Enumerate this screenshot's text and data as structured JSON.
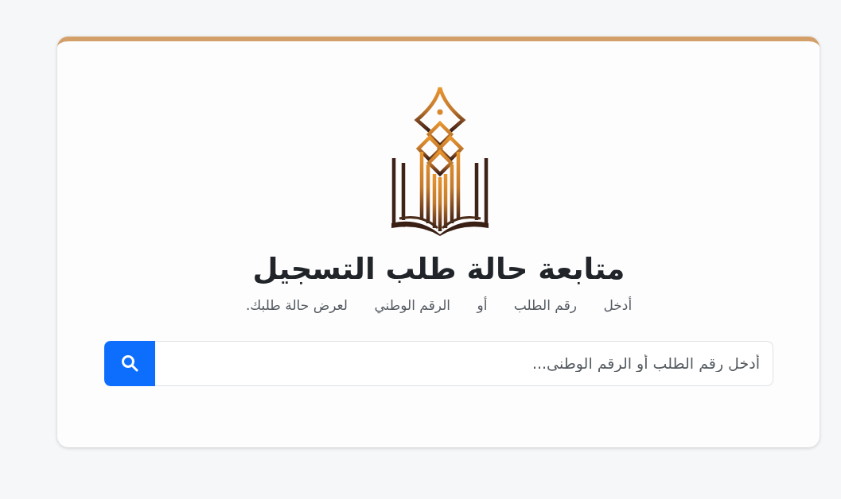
{
  "title": "متابعة حالة طلب التسجيل",
  "subtitle": [
    "أدخل",
    "رقم الطلب",
    "أو",
    "الرقم الوطني",
    "لعرض حالة طلبك."
  ],
  "search": {
    "placeholder": "أدخل رقم الطلب أو الرقم الوطنى..."
  }
}
